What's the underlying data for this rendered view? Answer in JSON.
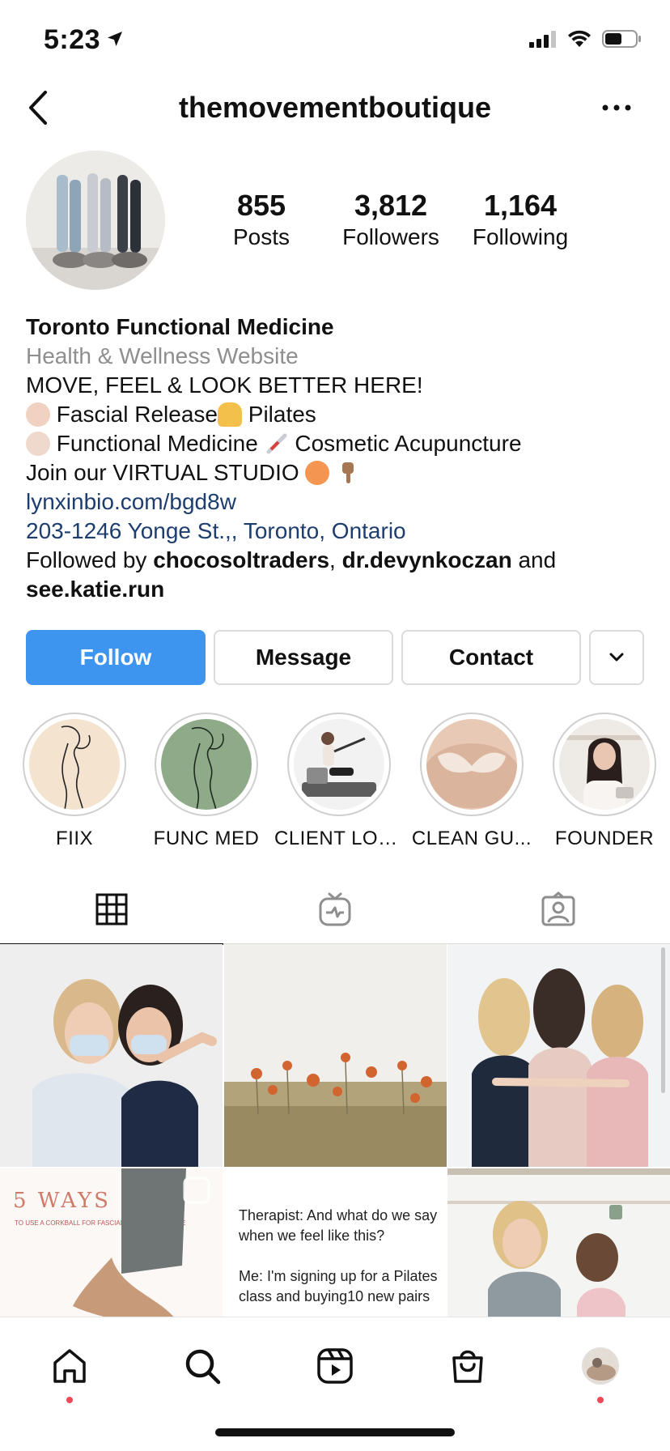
{
  "status_bar": {
    "time": "5:23"
  },
  "header": {
    "username": "themovementboutique"
  },
  "stats": [
    {
      "value": "855",
      "label": "Posts"
    },
    {
      "value": "3,812",
      "label": "Followers"
    },
    {
      "value": "1,164",
      "label": "Following"
    }
  ],
  "bio": {
    "name": "Toronto Functional Medicine",
    "category": "Health & Wellness Website",
    "line1": "MOVE, FEEL & LOOK BETTER HERE!",
    "line2_a": "Fascial Release",
    "line2_b": "Pilates",
    "line3_a": "Functional Medicine",
    "line3_b": "Cosmetic Acupuncture",
    "line4": "Join our VIRTUAL STUDIO",
    "link": "lynxinbio.com/bgd8w",
    "address": "203-1246 Yonge St.,, Toronto, Ontario",
    "followed_by_prefix": "Followed by",
    "followed_by_1": "chocosoltraders",
    "followed_by_sep": ",",
    "followed_by_2": "dr.devynkoczan",
    "followed_by_and": "and",
    "followed_by_3": "see.katie.run"
  },
  "actions": {
    "follow_label": "Follow",
    "message_label": "Message",
    "contact_label": "Contact"
  },
  "highlights": [
    {
      "label": "FIIX"
    },
    {
      "label": "FUNC MED"
    },
    {
      "label": "CLIENT LOVE"
    },
    {
      "label": "CLEAN GU..."
    },
    {
      "label": "FOUNDER"
    }
  ],
  "posts": {
    "p4_title": "5 WAYS",
    "p4_subtitle": "TO USE A CORKBALL FOR FASCIAL RELEASE AT HOME",
    "p5_line1": "Therapist: And what do we say when we feel like this?",
    "p5_line2": "Me: I'm signing up for a Pilates class and buying10 new pairs"
  },
  "colors": {
    "accent": "#3e95ef",
    "link": "#1d3d6f",
    "notify_dot": "#ed4956"
  }
}
